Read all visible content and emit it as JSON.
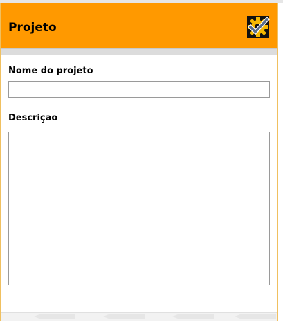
{
  "header": {
    "title": "Projeto",
    "accent_color": "#ff9900",
    "action_icon": "save-gear-check-icon"
  },
  "form": {
    "name_label": "Nome do projeto",
    "name_value": "",
    "description_label": "Descrição",
    "description_value": ""
  }
}
